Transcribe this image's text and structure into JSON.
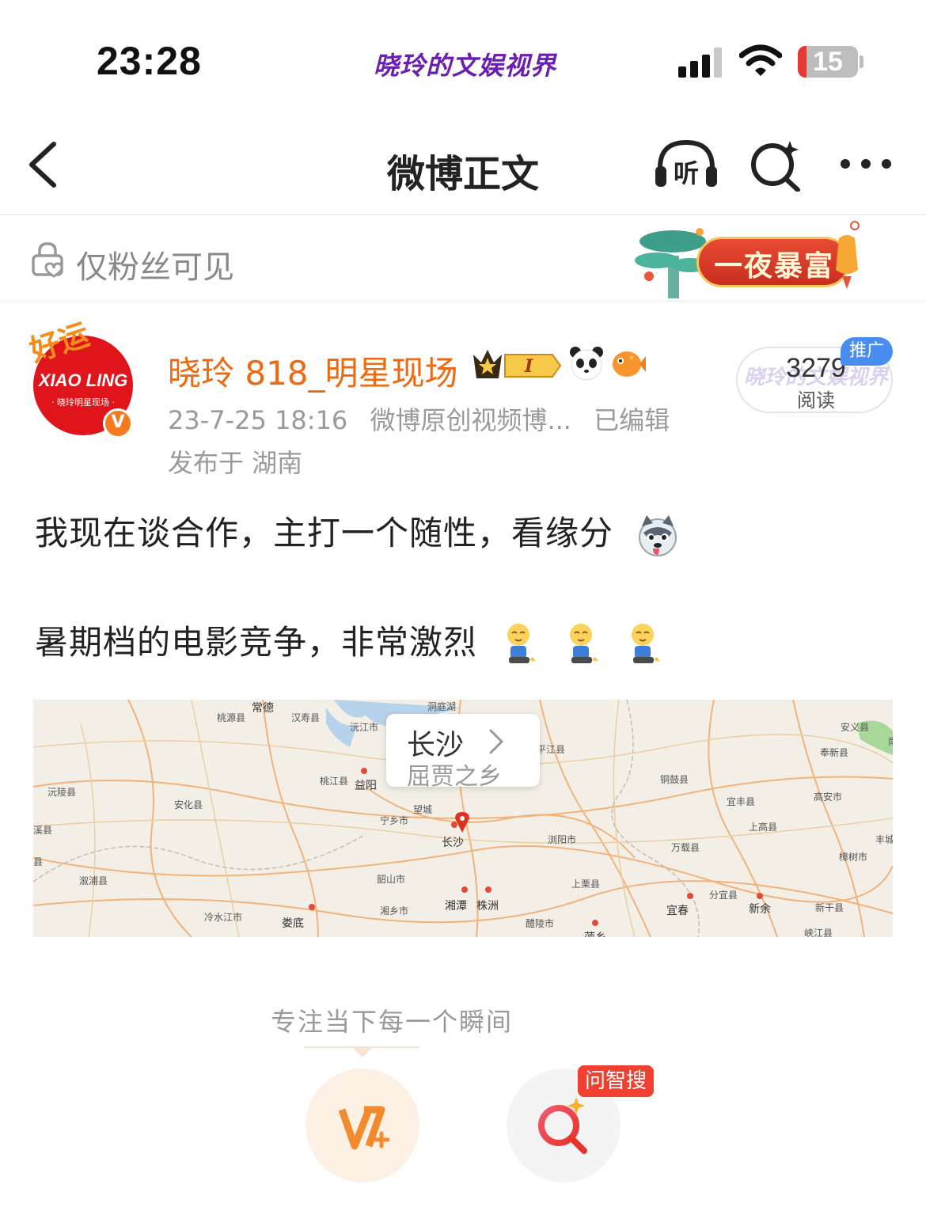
{
  "status_bar": {
    "time": "23:28",
    "watermark": "晓玲的文娱视界",
    "battery": 15
  },
  "header": {
    "title": "微博正文",
    "icons": [
      "back-icon",
      "listen-icon",
      "ai-search-icon",
      "more-icon"
    ]
  },
  "visibility_bar": {
    "label": "仅粉丝可见",
    "banner_text": "一夜暴富"
  },
  "post": {
    "avatar": {
      "deco": "好运",
      "name": "XIAO LING",
      "sub": "· 晓玲明星现场 ·"
    },
    "username": "晓玲 818_明星现场",
    "member_level": "I",
    "timestamp": "23-7-25 18:16",
    "source": "微博原创视频博...",
    "edited": "已编辑",
    "location": "发布于 湖南",
    "read_count": "3279",
    "read_label": "阅读",
    "promo_tag": "推广",
    "watermark": "晓玲的文娱视界",
    "content": [
      "我现在谈合作，主打一个随性，看缘分",
      "暑期档的电影竞争，非常激烈"
    ]
  },
  "map": {
    "callout_title": "长沙",
    "callout_subtitle": "屈贾之乡",
    "labels": [
      {
        "text": "常德",
        "big": true
      },
      {
        "text": "汉寿县"
      },
      {
        "text": "桃源县"
      },
      {
        "text": "洞庭湖"
      },
      {
        "text": "沅江市"
      },
      {
        "text": "平江县"
      },
      {
        "text": "安义县"
      },
      {
        "text": "奉新县"
      },
      {
        "text": "铜鼓县"
      },
      {
        "text": "宜丰县"
      },
      {
        "text": "高安市"
      },
      {
        "text": "桃江县"
      },
      {
        "text": "益阳",
        "big": true
      },
      {
        "text": "沅陵县"
      },
      {
        "text": "安化县"
      },
      {
        "text": "宁乡市"
      },
      {
        "text": "望城"
      },
      {
        "text": "长沙",
        "big": true
      },
      {
        "text": "浏阳市"
      },
      {
        "text": "万载县"
      },
      {
        "text": "上高县"
      },
      {
        "text": "樟树市"
      },
      {
        "text": "丰城"
      },
      {
        "text": "溆浦县"
      },
      {
        "text": "韶山市"
      },
      {
        "text": "上栗县"
      },
      {
        "text": "湘潭",
        "big": true
      },
      {
        "text": "株洲",
        "big": true
      },
      {
        "text": "冷水江市"
      },
      {
        "text": "娄底",
        "big": true
      },
      {
        "text": "湘乡市"
      },
      {
        "text": "醴陵市"
      },
      {
        "text": "萍乡",
        "big": true
      },
      {
        "text": "宜春",
        "big": true
      },
      {
        "text": "分宜县"
      },
      {
        "text": "新余",
        "big": true
      },
      {
        "text": "新干县"
      },
      {
        "text": "峡江县"
      },
      {
        "text": "溪县"
      },
      {
        "text": "县"
      },
      {
        "text": "南"
      }
    ]
  },
  "bottom": {
    "slogan": "专注当下每一个瞬间",
    "ai_search_tag": "问智搜"
  },
  "colors": {
    "accent_orange": "#eb6a12",
    "watermark_purple": "#6a1fb1",
    "promo_blue": "#4a8df0",
    "tag_red": "#f04130"
  }
}
